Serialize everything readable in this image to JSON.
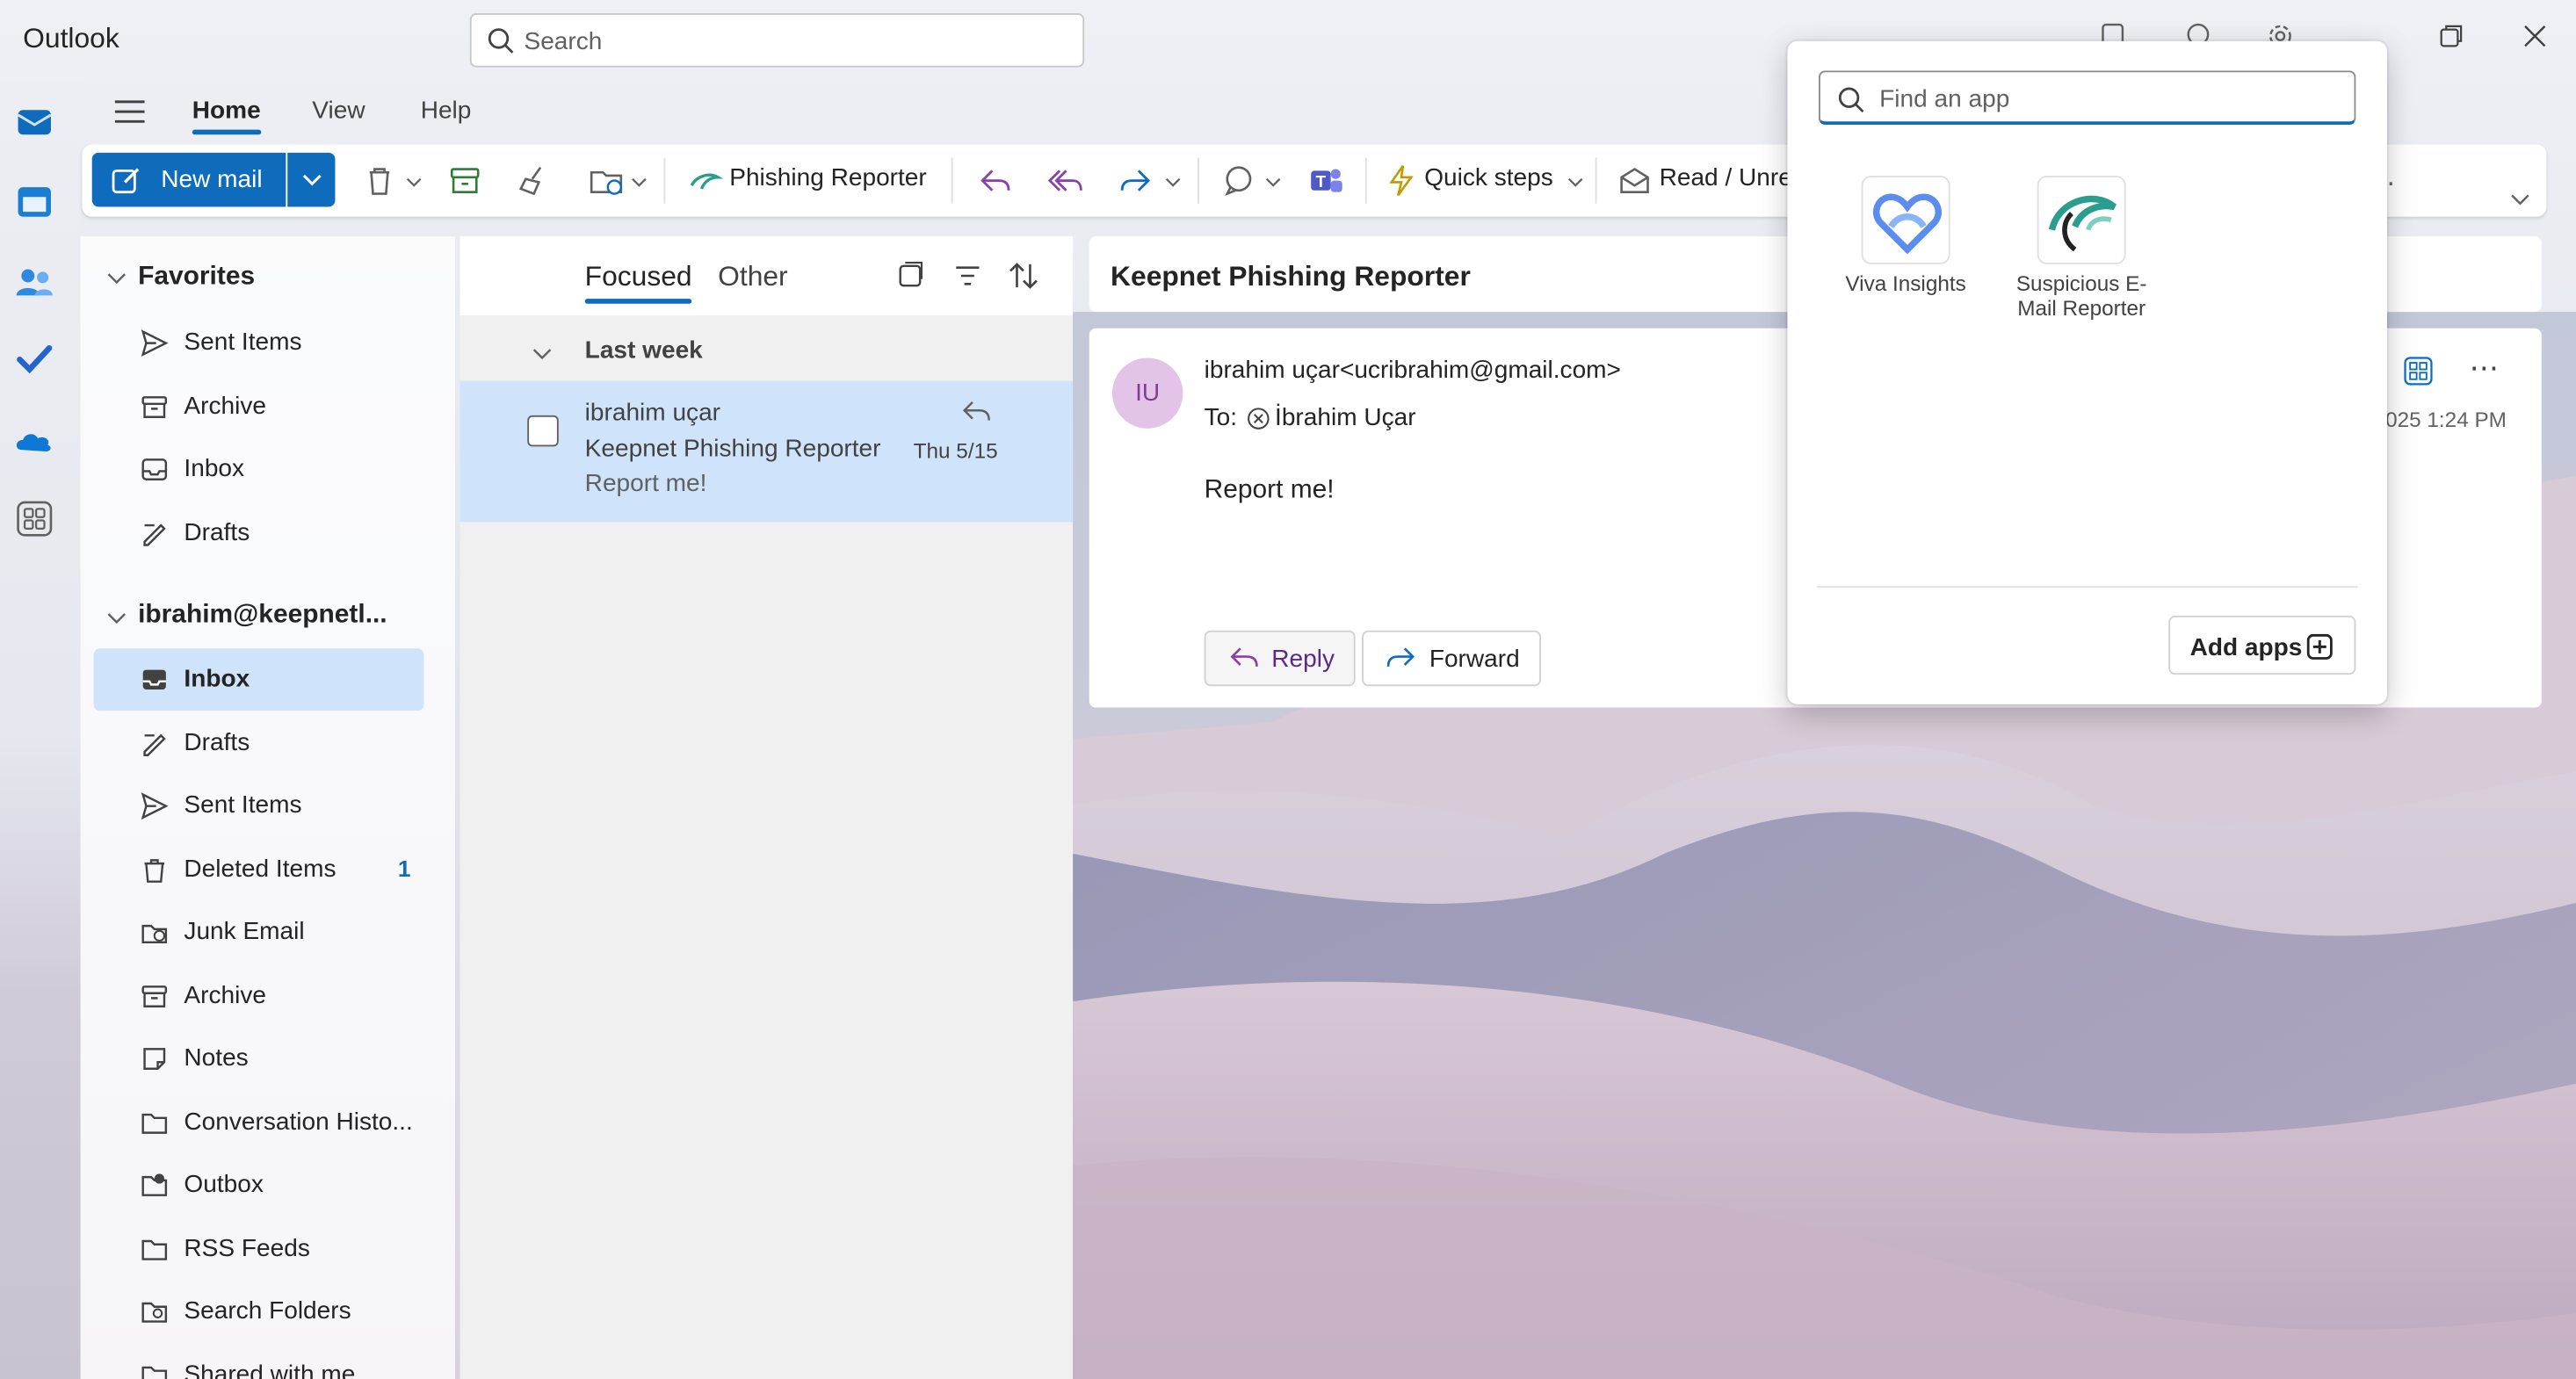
{
  "app": {
    "title": "Outlook"
  },
  "search": {
    "placeholder": "Search"
  },
  "ribbon": {
    "tabs": [
      "Home",
      "View",
      "Help"
    ],
    "new_mail": "New mail",
    "phishing_reporter": "Phishing Reporter",
    "quick_steps": "Quick steps",
    "read_unread": "Read / Unre"
  },
  "folders": {
    "favorites_title": "Favorites",
    "favorites": [
      {
        "label": "Sent Items",
        "icon": "send-icon"
      },
      {
        "label": "Archive",
        "icon": "archive-icon"
      },
      {
        "label": "Inbox",
        "icon": "inbox-icon"
      },
      {
        "label": "Drafts",
        "icon": "drafts-icon"
      }
    ],
    "account_title": "ibrahim@keepnetl...",
    "account": [
      {
        "label": "Inbox",
        "icon": "inbox-icon",
        "selected": true
      },
      {
        "label": "Drafts",
        "icon": "drafts-icon"
      },
      {
        "label": "Sent Items",
        "icon": "send-icon"
      },
      {
        "label": "Deleted Items",
        "icon": "trash-icon",
        "count": "1"
      },
      {
        "label": "Junk Email",
        "icon": "junk-icon"
      },
      {
        "label": "Archive",
        "icon": "archive-icon"
      },
      {
        "label": "Notes",
        "icon": "notes-icon"
      },
      {
        "label": "Conversation Histo...",
        "icon": "folder-icon"
      },
      {
        "label": "Outbox",
        "icon": "outbox-icon"
      },
      {
        "label": "RSS Feeds",
        "icon": "folder-icon"
      },
      {
        "label": "Search Folders",
        "icon": "search-folder-icon"
      },
      {
        "label": "Shared with me",
        "icon": "shared-icon"
      }
    ]
  },
  "message_list": {
    "pivot_focused": "Focused",
    "pivot_other": "Other",
    "group": "Last week",
    "items": [
      {
        "sender": "ibrahim uçar",
        "subject": "Keepnet Phishing Reporter",
        "date": "Thu 5/15",
        "preview": "Report me!"
      }
    ]
  },
  "reading": {
    "subject": "Keepnet Phishing Reporter",
    "avatar_initials": "IU",
    "from": "ibrahim uçar<ucribrahim@gmail.com>",
    "to_label": "To:",
    "to_name": "İbrahim Uçar",
    "date": "025 1:24 PM",
    "body": "Report me!",
    "reply": "Reply",
    "forward": "Forward"
  },
  "app_picker": {
    "placeholder": "Find an app",
    "apps": [
      {
        "label": "Viva Insights",
        "icon": "viva-insights-icon"
      },
      {
        "label": "Suspicious E-Mail Reporter",
        "icon": "suspicious-reporter-icon"
      }
    ],
    "add_apps": "Add apps"
  },
  "colors": {
    "accent": "#0f6cbd",
    "selected_bg": "#cfe4fa"
  }
}
